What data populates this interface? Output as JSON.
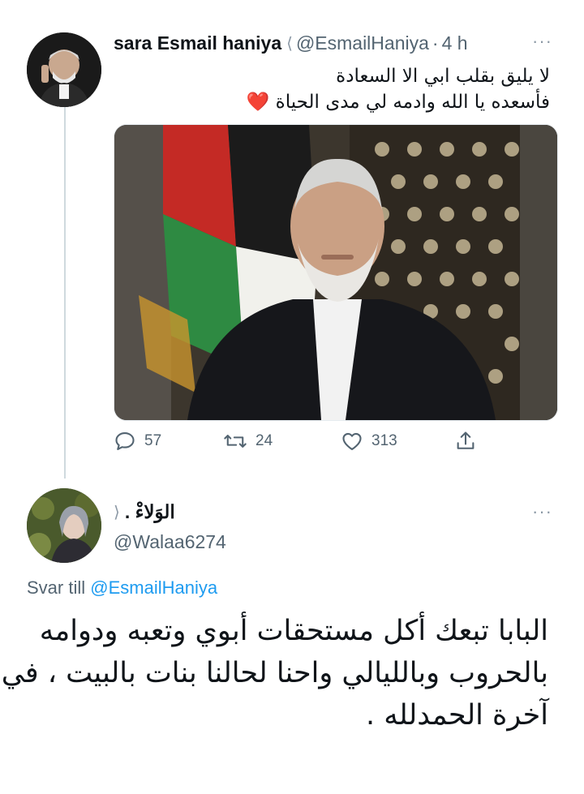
{
  "tweet": {
    "author_name": "sara Esmail haniya",
    "verified_glyph": "⟨",
    "handle": "@EsmailHaniya",
    "separator": "·",
    "time": "4 h",
    "more_label": "···",
    "text_line1": "لا يليق بقلب ابي الا السعادة",
    "text_line2": "فأسعده يا الله وادمه لي مدى الحياة",
    "heart_emoji": "❤️",
    "media_icon": "portrait-photo",
    "stats": {
      "replies": "57",
      "retweets": "24",
      "likes": "313"
    }
  },
  "reply": {
    "author_name": "الوَلاءْ .",
    "verified_glyph": "⟨",
    "handle": "@Walaa6274",
    "more_label": "···",
    "reply_to_prefix": "Svar till",
    "reply_to_handle": "@EsmailHaniya",
    "text_line1": "البابا تبعك أكل مستحقات أبوي وتعبه ودوامه",
    "text_line2": "بالحروب وبالليالي واحنا لحالنا بنات بالبيت ، في",
    "text_line3": "آخرة الحمدلله ."
  },
  "colors": {
    "text": "#0f1419",
    "secondary": "#536471",
    "link": "#1d9bf0",
    "thread_line": "#cfd9de",
    "heart": "#e0245e"
  }
}
